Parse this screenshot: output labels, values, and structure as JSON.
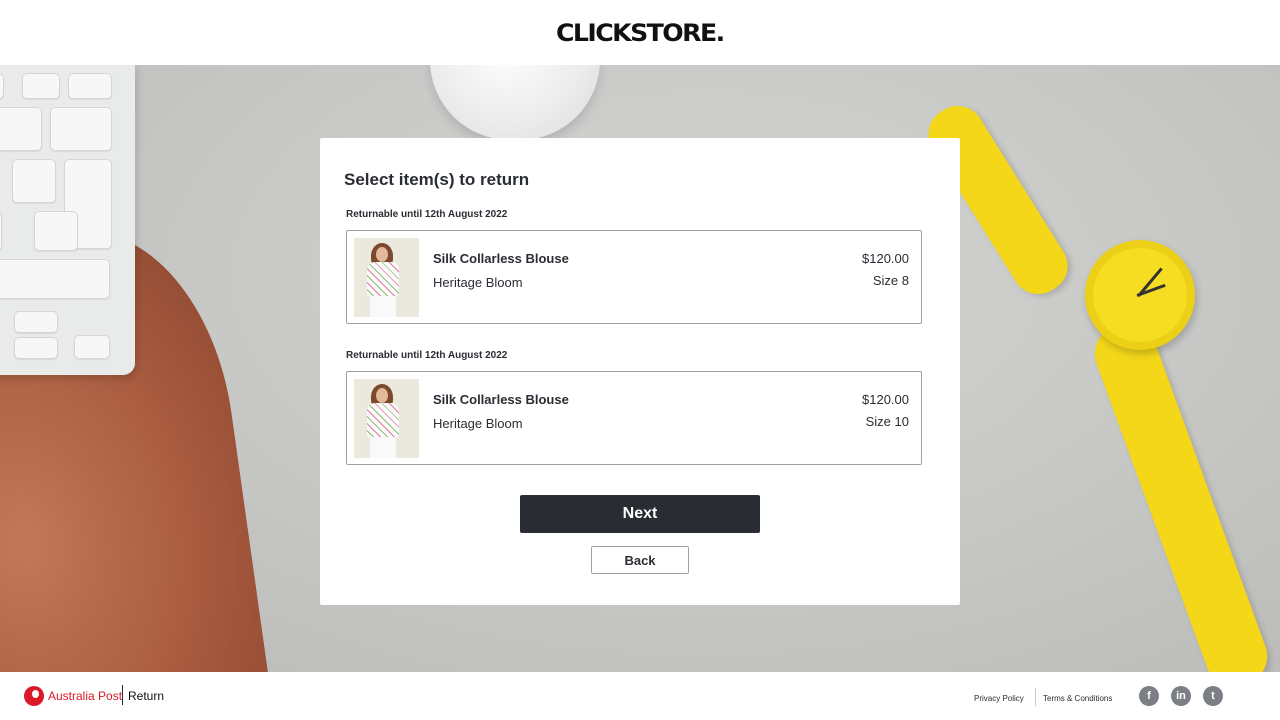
{
  "header": {
    "logo": "CLICKSTORE."
  },
  "card": {
    "title": "Select item(s) to return",
    "items": [
      {
        "returnable": "Returnable until 12th August 2022",
        "name": "Silk Collarless Blouse",
        "variant": "Heritage Bloom",
        "price": "$120.00",
        "size": "Size 8"
      },
      {
        "returnable": "Returnable until 12th August 2022",
        "name": "Silk Collarless Blouse",
        "variant": "Heritage Bloom",
        "price": "$120.00",
        "size": "Size 10"
      }
    ],
    "next_label": "Next",
    "back_label": "Back"
  },
  "footer": {
    "brand": "Australia Post",
    "product": "Return",
    "privacy": "Privacy Policy",
    "terms": "Terms & Conditions",
    "social": [
      {
        "icon": "facebook-icon",
        "glyph": "f"
      },
      {
        "icon": "linkedin-icon",
        "glyph": "in"
      },
      {
        "icon": "twitter-icon",
        "glyph": "t"
      }
    ]
  },
  "colors": {
    "accent_dark": "#292d33",
    "brand_red": "#dc1928",
    "watch_yellow": "#f4d719"
  }
}
